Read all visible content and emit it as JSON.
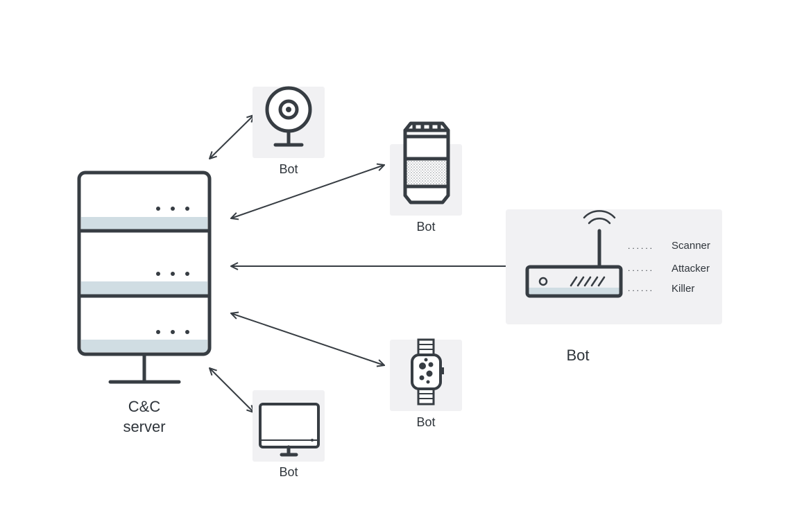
{
  "colors": {
    "stroke": "#373d43",
    "accent_strip": "#d0dde3"
  },
  "server": {
    "label_line1": "C&C",
    "label_line2": "server"
  },
  "bots": {
    "webcam": {
      "label": "Bot"
    },
    "speaker": {
      "label": "Bot"
    },
    "router": {
      "label": "Bot",
      "modules": [
        "Scanner",
        "Attacker",
        "Killer"
      ]
    },
    "watch": {
      "label": "Bot"
    },
    "monitor": {
      "label": "Bot"
    }
  }
}
